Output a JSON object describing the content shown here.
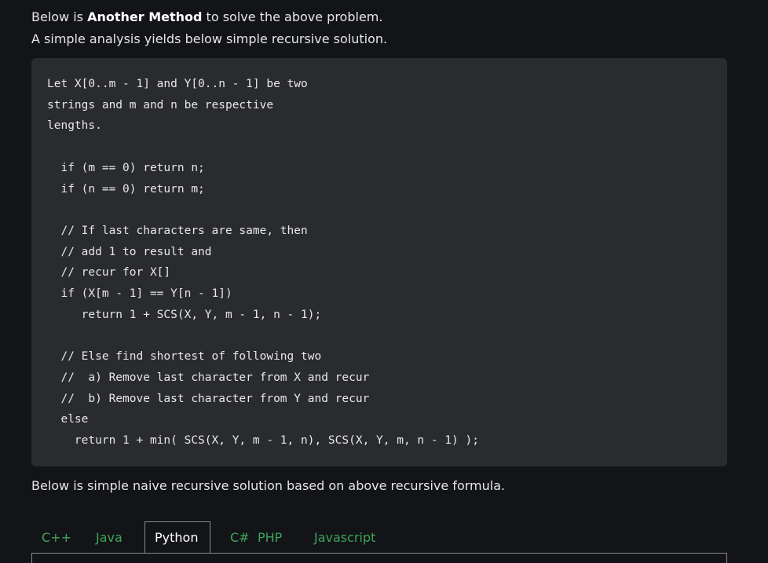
{
  "intro": {
    "line1_prefix": "Below is ",
    "line1_bold": "Another Method",
    "line1_suffix": " to solve the above problem.",
    "line2": "A simple analysis yields below simple recursive solution."
  },
  "code": "Let X[0..m - 1] and Y[0..n - 1] be two\nstrings and m and n be respective\nlengths.\n\n  if (m == 0) return n;\n  if (n == 0) return m;\n\n  // If last characters are same, then\n  // add 1 to result and\n  // recur for X[]\n  if (X[m - 1] == Y[n - 1])\n     return 1 + SCS(X, Y, m - 1, n - 1);\n\n  // Else find shortest of following two\n  //  a) Remove last character from X and recur\n  //  b) Remove last character from Y and recur\n  else\n    return 1 + min( SCS(X, Y, m - 1, n), SCS(X, Y, m, n - 1) );",
  "line3": "Below is simple naive recursive solution based on above recursive formula.",
  "tabs": [
    "C++",
    "Java",
    "Python",
    "C#",
    "PHP",
    "Javascript"
  ],
  "active_tab": "Python",
  "colors": {
    "background": "#131417",
    "code_background": "#2a2b2f",
    "tab_text": "#3fa35b",
    "active_tab_text": "#ffffff"
  }
}
